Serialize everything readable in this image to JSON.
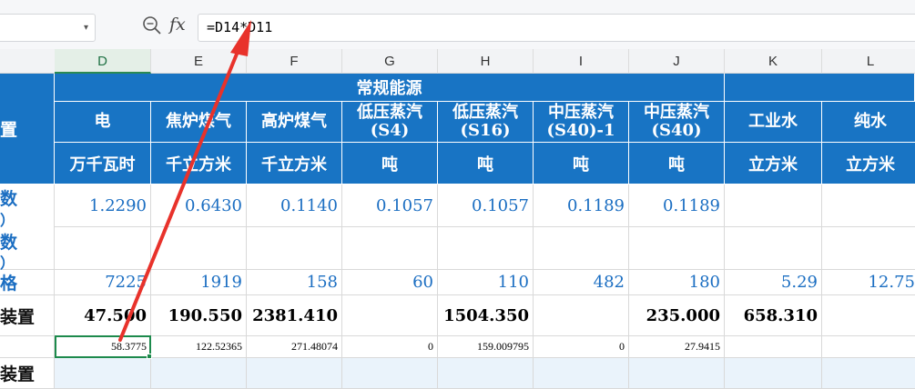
{
  "formula_bar": {
    "name_box_value": "",
    "fx_label": "fx",
    "formula": "=D14*D11"
  },
  "columns": [
    "D",
    "E",
    "F",
    "G",
    "H",
    "I",
    "J",
    "K",
    "L"
  ],
  "table": {
    "group_header": "常规能源",
    "row_labels": [
      "置",
      "数",
      "）",
      "数",
      "）",
      "格",
      "装置",
      "装置"
    ],
    "names": [
      "电",
      "焦炉煤气",
      "高炉煤气",
      "低压蒸汽",
      "(S4)",
      "低压蒸汽",
      "(S16)",
      "中压蒸汽",
      "(S40)-1",
      "中压蒸汽",
      "(S40)",
      "工业水",
      "纯水"
    ],
    "units": [
      "万千瓦时",
      "千立方米",
      "千立方米",
      "吨",
      "吨",
      "吨",
      "吨",
      "立方米",
      "立方米"
    ],
    "factors": [
      "1.2290",
      "0.6430",
      "0.1140",
      "0.1057",
      "0.1057",
      "0.1189",
      "0.1189",
      "",
      ""
    ],
    "prices": [
      "7225",
      "1919",
      "158",
      "60",
      "110",
      "482",
      "180",
      "5.29",
      "12.75"
    ],
    "quantities": [
      "47.500",
      "190.550",
      "2381.410",
      "",
      "1504.350",
      "",
      "235.000",
      "658.310",
      ""
    ],
    "results": [
      "58.3775",
      "122.52365",
      "271.48074",
      "0",
      "159.009795",
      "0",
      "27.9415",
      "",
      ""
    ]
  },
  "annotation": {
    "arrow_color": "#e8322b"
  }
}
